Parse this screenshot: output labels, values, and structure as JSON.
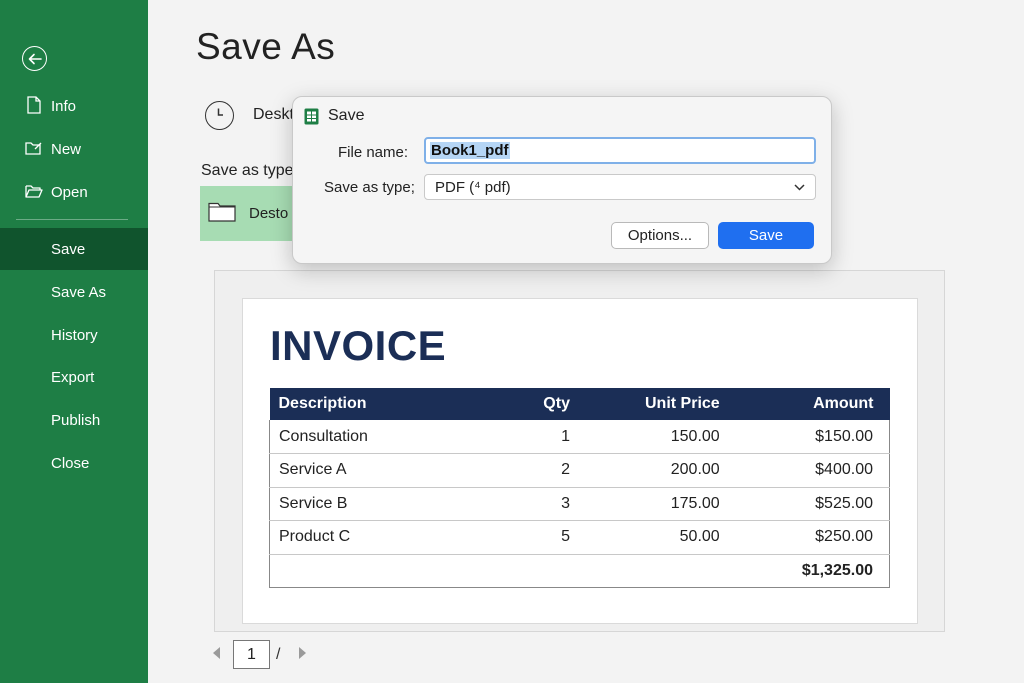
{
  "sidebar": {
    "back_icon": "arrow-left-icon",
    "items": [
      {
        "label": "Info",
        "icon": "document-icon"
      },
      {
        "label": "New",
        "icon": "new-file-icon"
      },
      {
        "label": "Open",
        "icon": "folder-open-icon"
      },
      {
        "label": "Save",
        "active": true
      },
      {
        "label": "Save As"
      },
      {
        "label": "History"
      },
      {
        "label": "Export"
      },
      {
        "label": "Publish"
      },
      {
        "label": "Close"
      }
    ],
    "colors": {
      "background": "#1e7e45",
      "active": "#10542d"
    }
  },
  "main": {
    "title": "Save As",
    "recent_label": "Deskt",
    "save_as_type_label": "Save as type",
    "folder_label": "Desto"
  },
  "dialog": {
    "title": "Save",
    "file_name_label": "File name:",
    "file_name_value": "Book1_pdf",
    "save_as_type_label": "Save as type;",
    "save_as_type_value": "PDF (⁴ pdf)",
    "options_button": "Options...",
    "save_button": "Save",
    "accent_color": "#1f6ff0"
  },
  "preview": {
    "invoice_title": "INVOICE",
    "headers": [
      "Description",
      "Qty",
      "Unit Price",
      "Amount"
    ],
    "rows": [
      [
        "Consultation",
        "1",
        "150.00",
        "$150.00"
      ],
      [
        "Service A",
        "2",
        "200.00",
        "$400.00"
      ],
      [
        "Service B",
        "3",
        "175.00",
        "$525.00"
      ],
      [
        "Product C",
        "5",
        "50.00",
        "$250.00"
      ]
    ],
    "total": "$1,325.00",
    "header_color": "#1b2e56"
  },
  "pager": {
    "current_page": "1",
    "separator": "/"
  }
}
